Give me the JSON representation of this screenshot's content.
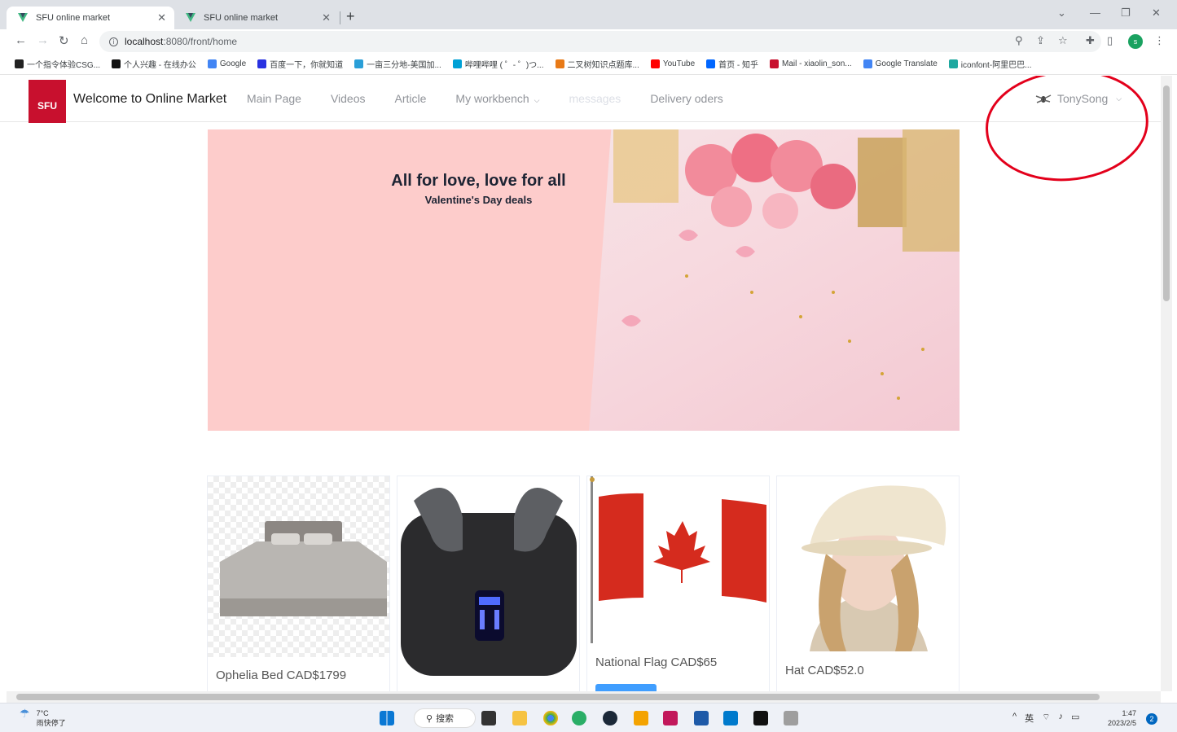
{
  "browser": {
    "tabs": [
      {
        "title": "SFU online market",
        "active": true
      },
      {
        "title": "SFU online market",
        "active": false
      }
    ],
    "new_tab": "+",
    "close_glyph": "✕",
    "url_host": "localhost",
    "url_rest": ":8080/front/home",
    "bookmarks": [
      {
        "label": "一个指令体验CSG...",
        "color": "#222"
      },
      {
        "label": "个人兴趣 - 在线办公",
        "color": "#111"
      },
      {
        "label": "Google",
        "color": "#4285f4"
      },
      {
        "label": "百度一下，你就知道",
        "color": "#2932e1"
      },
      {
        "label": "一亩三分地-美国加...",
        "color": "#2a9fd8"
      },
      {
        "label": "哔哩哔哩 ( ゜- ゜)つ...",
        "color": "#00a1d6"
      },
      {
        "label": "二叉树知识点题库...",
        "color": "#e87a17"
      },
      {
        "label": "YouTube",
        "color": "#ff0000"
      },
      {
        "label": "首页 - 知乎",
        "color": "#0066ff"
      },
      {
        "label": "Mail - xiaolin_son...",
        "color": "#c8102e"
      },
      {
        "label": "Google Translate",
        "color": "#4285f4"
      },
      {
        "label": "iconfont-阿里巴巴...",
        "color": "#1fa8a0"
      }
    ],
    "profile_initial": "s"
  },
  "header": {
    "logo_text": "SFU",
    "brand": "Welcome to Online Market",
    "menu": [
      {
        "label": "Main Page",
        "disabled": false,
        "dropdown": false
      },
      {
        "label": "Videos",
        "disabled": false,
        "dropdown": false
      },
      {
        "label": "Article",
        "disabled": false,
        "dropdown": false
      },
      {
        "label": "My workbench",
        "disabled": false,
        "dropdown": true
      },
      {
        "label": "messages",
        "disabled": true,
        "dropdown": false
      },
      {
        "label": "Delivery oders",
        "disabled": false,
        "dropdown": false
      }
    ],
    "username": "TonySong",
    "caret": "⌵"
  },
  "banner": {
    "title": "All for love, love for all",
    "subtitle": "Valentine's Day deals"
  },
  "products": [
    {
      "caption": "Ophelia Bed CAD$1799",
      "icon": "bed-image"
    },
    {
      "caption": "",
      "icon": "earbuds-image"
    },
    {
      "caption": "National Flag CAD$65",
      "icon": "canada-flag-image"
    },
    {
      "caption": "Hat CAD$52.0",
      "icon": "knit-hat-image"
    }
  ],
  "taskbar": {
    "temperature": "7°C",
    "weather_text": "雨快停了",
    "search_label": "搜索",
    "tray_items": [
      "^",
      "英"
    ],
    "time": "1:47",
    "date": "2023/2/5",
    "notifications": "2"
  },
  "colors": {
    "accent": "#409eff",
    "sfu_red": "#c8102e",
    "banner_pink": "#fdcccb",
    "annotation_red": "#e3001b"
  }
}
